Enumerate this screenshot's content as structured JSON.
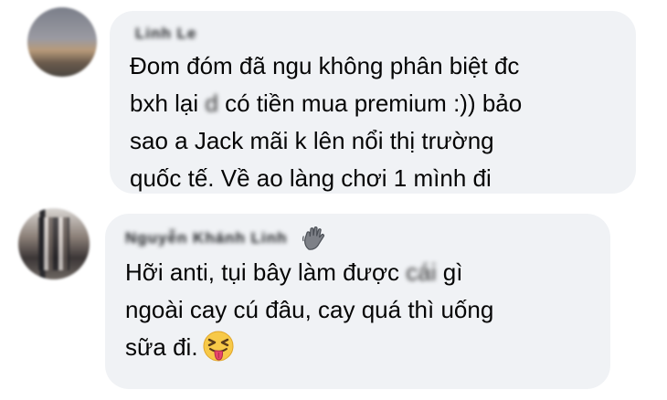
{
  "comments": [
    {
      "author": "Linh Le",
      "line1": "Đom đóm đã ngu không phân biệt đc",
      "line2_a": "bxh lại ",
      "line2_blur": "d",
      "line2_b": " có tiền mua premium :)) bảo",
      "line3": "sao a Jack mãi k lên nổi thị trường",
      "line4": "quốc tế. Về ao làng chơi 1 mình đi"
    },
    {
      "author": "Nguyễn Khánh Linh",
      "badge_icon": "waving-hand-icon",
      "line1_a": "Hỡi anti, tụi bây làm được ",
      "line1_blur": "cái ",
      "line1_b": "gì",
      "line2": "ngoài cay cú đâu, cay quá thì uống",
      "line3": "sữa đi.",
      "emoji_icon": "squinting-tongue-face-icon"
    }
  ]
}
